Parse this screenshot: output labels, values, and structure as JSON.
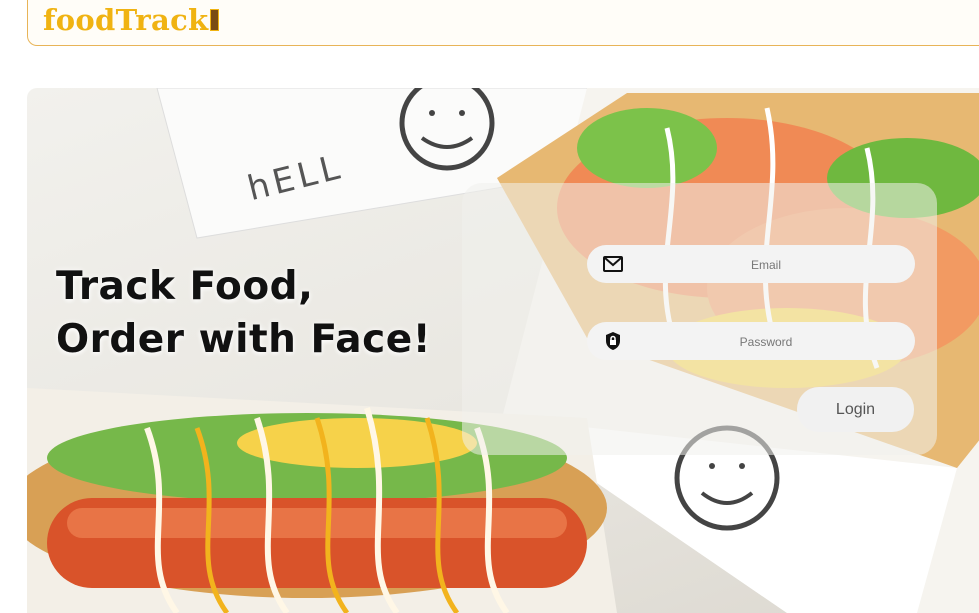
{
  "navbar": {
    "logo_text": "foodTrack"
  },
  "hero": {
    "headline_line1": "Track Food,",
    "headline_line2": "Order with Face!",
    "box_print": "hELL"
  },
  "login": {
    "email_placeholder": "Email",
    "password_placeholder": "Password",
    "login_label": "Login",
    "email_icon": "envelope-icon",
    "password_icon": "lock-icon"
  }
}
